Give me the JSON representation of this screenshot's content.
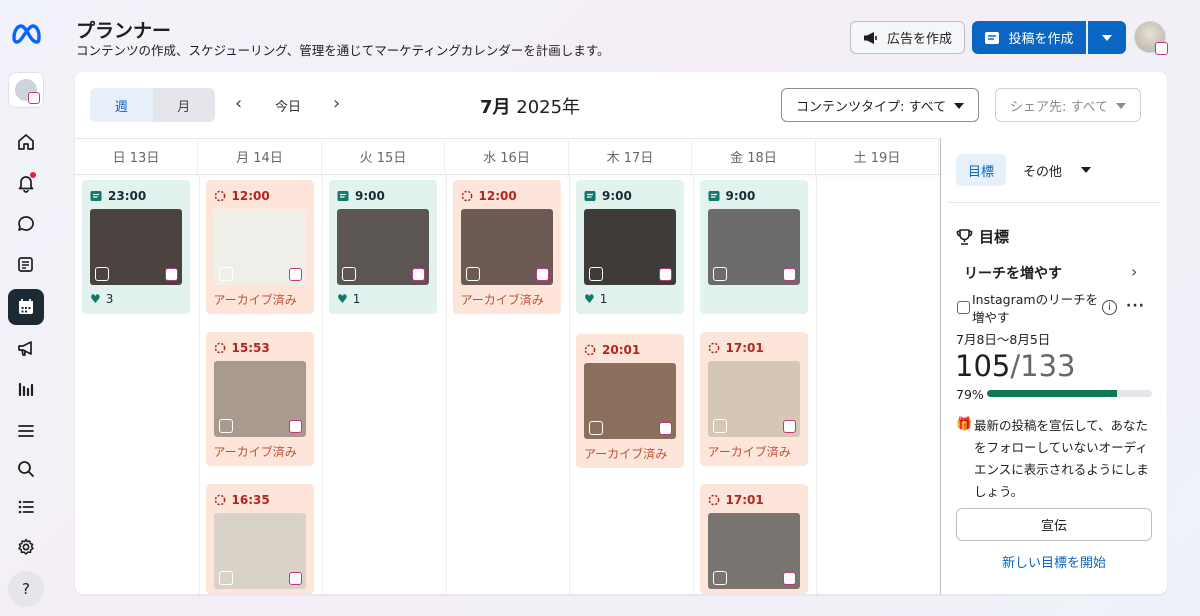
{
  "header": {
    "title": "プランナー",
    "subtitle": "コンテンツの作成、スケジューリング、管理を通じてマーケティングカレンダーを計画します。",
    "create_ad_label": "広告を作成",
    "create_post_label": "投稿を作成"
  },
  "sidebar": {
    "items": [
      {
        "name": "home-icon"
      },
      {
        "name": "bell-icon"
      },
      {
        "name": "chat-icon"
      },
      {
        "name": "content-icon"
      },
      {
        "name": "calendar-icon",
        "active": true
      },
      {
        "name": "megaphone-icon"
      },
      {
        "name": "insights-icon"
      },
      {
        "name": "menu-icon"
      },
      {
        "name": "search-icon"
      },
      {
        "name": "list-icon"
      },
      {
        "name": "gear-icon"
      },
      {
        "name": "help-icon"
      }
    ]
  },
  "toolbar": {
    "view_week": "週",
    "view_month": "月",
    "today": "今日",
    "month_label_bold": "7月",
    "year_label": " 2025年",
    "content_type_filter": "コンテンツタイプ: すべて",
    "share_filter": "シェア先: すべて"
  },
  "days": [
    "日 13日",
    "月 14日",
    "火 15日",
    "水 16日",
    "木 17日",
    "金 18日",
    "土 19日"
  ],
  "posts": [
    {
      "day": 0,
      "slot": 0,
      "time": "23:00",
      "state": "published",
      "likes": "3",
      "thumb": "#4a4340"
    },
    {
      "day": 1,
      "slot": 0,
      "time": "12:00",
      "state": "archived",
      "status": "アーカイブ済み",
      "thumb": "#f0eee9"
    },
    {
      "day": 1,
      "slot": 1,
      "time": "15:53",
      "state": "archived",
      "status": "アーカイブ済み",
      "thumb": "#a89a8e"
    },
    {
      "day": 1,
      "slot": 2,
      "time": "16:35",
      "state": "archived",
      "status": "",
      "thumb": "#d9d2c9"
    },
    {
      "day": 2,
      "slot": 0,
      "time": "9:00",
      "state": "published",
      "likes": "1",
      "thumb": "#5c5652"
    },
    {
      "day": 3,
      "slot": 0,
      "time": "12:00",
      "state": "archived",
      "status": "アーカイブ済み",
      "thumb": "#6d5a55"
    },
    {
      "day": 4,
      "slot": 0,
      "time": "9:00",
      "state": "published",
      "likes": "1",
      "thumb": "#3f3b38"
    },
    {
      "day": 4,
      "slot": 1,
      "time": "20:01",
      "state": "archived",
      "status": "アーカイブ済み",
      "thumb": "#8a6f5c"
    },
    {
      "day": 5,
      "slot": 0,
      "time": "9:00",
      "state": "published",
      "likes": "",
      "thumb": "#6b6b6b"
    },
    {
      "day": 5,
      "slot": 1,
      "time": "17:01",
      "state": "archived",
      "status": "アーカイブ済み",
      "thumb": "#d6c7b4"
    },
    {
      "day": 5,
      "slot": 2,
      "time": "17:01",
      "state": "archived",
      "status": "",
      "thumb": "#7a7470"
    }
  ],
  "panel": {
    "tab_goal": "目標",
    "tab_other": "その他",
    "heading": "目標",
    "goal_name": "リーチを増やす",
    "goal_desc": "Instagramのリーチを増やす",
    "dates": "7月8日〜8月5日",
    "current": "105",
    "target": "/133",
    "percent": "79%",
    "progress": 0.79,
    "tip": "最新の投稿を宣伝して、あなたをフォローしていないオーディエンスに表示されるようにしましょう。",
    "promote_label": "宣伝",
    "new_goal_link": "新しい目標を開始"
  }
}
